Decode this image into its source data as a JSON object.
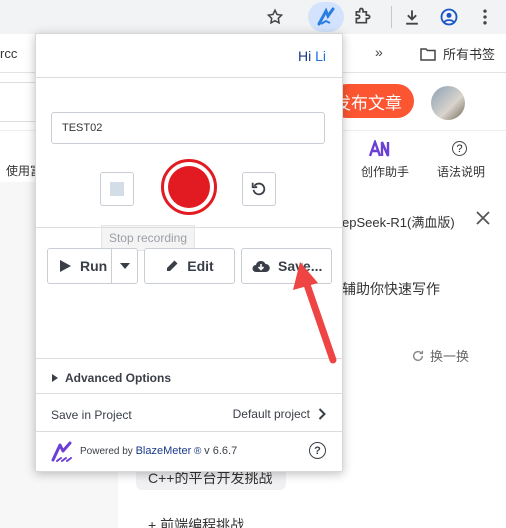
{
  "browser": {
    "bookmarks": {
      "left_item": "rcc",
      "all_bookmarks": "所有书签"
    }
  },
  "page": {
    "publish_button": "发布文章",
    "toolbar_left": "使用富",
    "creation_assistant": "创作助手",
    "grammar_help": "语法说明",
    "deepseek_title": "epSeek-R1(满血版)",
    "assist_text": "辅助你快速写作",
    "refresh": "换一换",
    "chip_1": "C++的平台开发挑战",
    "chip_2": "+ 前端编程挑战"
  },
  "popup": {
    "greeting": "Hi",
    "user_name": "Li",
    "test_name": "TEST02",
    "stop_tooltip": "Stop recording",
    "run_label": "Run",
    "edit_label": "Edit",
    "save_label": "Save...",
    "advanced_options": "Advanced Options",
    "save_in_project": "Save in Project",
    "default_project": "Default project",
    "powered_by": "Powered by",
    "brand": "BlazeMeter",
    "version": "v 6.6.7",
    "help": "?"
  },
  "colors": {
    "record_red": "#e21b23",
    "brand_blue": "#1a3a8a",
    "publish_orange": "#fc5531",
    "arrow_red": "#ee4444"
  }
}
